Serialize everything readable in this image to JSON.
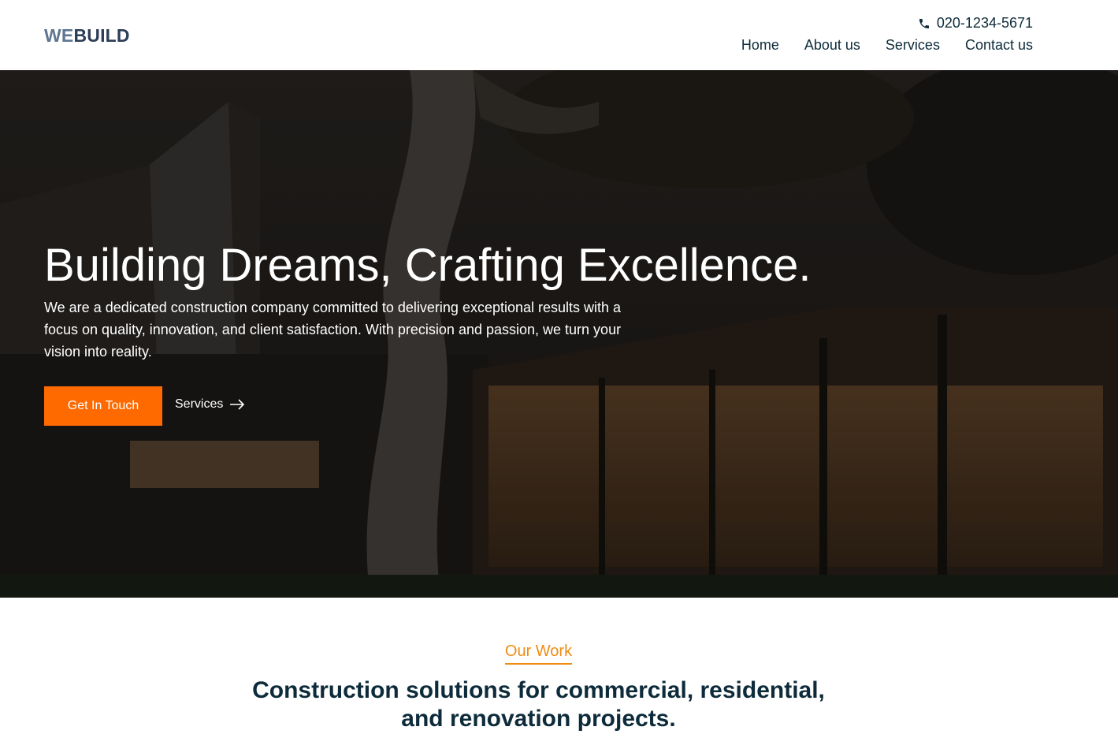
{
  "header": {
    "logo_part1": "WE",
    "logo_part2": "BUILD",
    "phone": "020-1234-5671",
    "phone_icon": "phone-icon",
    "nav": [
      "Home",
      "About us",
      "Services",
      "Contact us"
    ]
  },
  "hero": {
    "title": "Building Dreams, Crafting Excellence.",
    "description": "We are a dedicated construction company committed to delivering exceptional results with a focus on quality, innovation, and client satisfaction. With precision and passion, we turn your vision into reality.",
    "cta_label": "Get In Touch",
    "services_label": "Services",
    "services_icon": "arrow-right-icon"
  },
  "work": {
    "label": "Our Work",
    "title_line1": "Construction solutions for commercial, residential,",
    "title_line2": "and renovation projects."
  },
  "colors": {
    "accent": "#ff6a00",
    "label_accent": "#f08c12",
    "text_dark": "#0d2b3a"
  }
}
